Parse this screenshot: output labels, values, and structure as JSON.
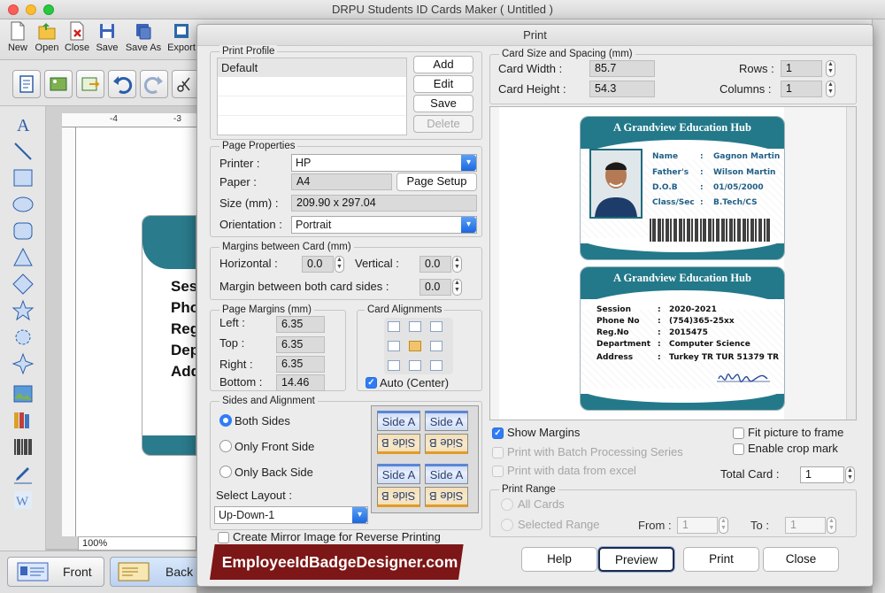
{
  "app": {
    "title": "DRPU Students ID Cards Maker ( Untitled )"
  },
  "toolbar": {
    "new": "New",
    "open": "Open",
    "close": "Close",
    "save": "Save",
    "save_as": "Save As",
    "export": "Export"
  },
  "canvas": {
    "ruler_ticks": [
      "-4",
      "-3"
    ],
    "zoom": "100%",
    "card_lines": [
      "Sess",
      "Pho",
      "Reg",
      "Dep",
      "Add"
    ]
  },
  "bottom_tabs": {
    "front": "Front",
    "back": "Back"
  },
  "dialog": {
    "title": "Print",
    "print_profile": {
      "legend": "Print Profile",
      "items": [
        "Default"
      ],
      "add": "Add",
      "edit": "Edit",
      "save": "Save",
      "delete": "Delete"
    },
    "page_properties": {
      "legend": "Page Properties",
      "printer_label": "Printer :",
      "printer_value": "HP",
      "paper_label": "Paper :",
      "paper_value": "A4",
      "page_setup": "Page Setup",
      "size_label": "Size (mm) :",
      "size_value": "209.90 x 297.04",
      "orientation_label": "Orientation :",
      "orientation_value": "Portrait"
    },
    "margins_between_card": {
      "legend": "Margins between Card (mm)",
      "horizontal_label": "Horizontal :",
      "horizontal_value": "0.0",
      "vertical_label": "Vertical :",
      "vertical_value": "0.0",
      "both_sides_label": "Margin between both card sides :",
      "both_sides_value": "0.0"
    },
    "page_margins": {
      "legend": "Page Margins (mm)",
      "left_label": "Left :",
      "left_value": "6.35",
      "top_label": "Top :",
      "top_value": "6.35",
      "right_label": "Right :",
      "right_value": "6.35",
      "bottom_label": "Bottom :",
      "bottom_value": "14.46"
    },
    "card_alignments": {
      "legend": "Card Alignments",
      "auto_center": "Auto (Center)",
      "auto_center_checked": true
    },
    "sides": {
      "legend": "Sides and Alignment",
      "both": "Both Sides",
      "front_only": "Only Front Side",
      "back_only": "Only Back Side",
      "selected": "both",
      "select_layout_label": "Select Layout :",
      "layout_value": "Up-Down-1",
      "tile_a": "Side A",
      "tile_b": "Side B"
    },
    "mirror": "Create Mirror Image for Reverse Printing",
    "card_size": {
      "legend": "Card Size and Spacing (mm)",
      "width_label": "Card Width :",
      "width_value": "85.7",
      "height_label": "Card Height :",
      "height_value": "54.3",
      "rows_label": "Rows :",
      "rows_value": "1",
      "columns_label": "Columns :",
      "columns_value": "1"
    },
    "preview": {
      "front": {
        "school": "A Grandview Education Hub",
        "fields": [
          {
            "k": "Name",
            "v": "Gagnon Martin"
          },
          {
            "k": "Father's",
            "v": "Wilson Martin"
          },
          {
            "k": "D.O.B",
            "v": "01/05/2000"
          },
          {
            "k": "Class/Sec",
            "v": "B.Tech/CS"
          }
        ]
      },
      "back": {
        "school": "A Grandview Education Hub",
        "fields": [
          {
            "k": "Session",
            "v": "2020-2021"
          },
          {
            "k": "Phone No",
            "v": "(754)365-25xx"
          },
          {
            "k": "Reg.No",
            "v": "2015475"
          },
          {
            "k": "Department",
            "v": "Computer Science"
          },
          {
            "k": "Address",
            "v": "Turkey TR TUR 51379 TR"
          }
        ]
      }
    },
    "options": {
      "show_margins": "Show Margins",
      "batch": "Print with Batch Processing Series",
      "excel": "Print with data from excel",
      "fit_picture": "Fit picture to frame",
      "crop_mark": "Enable crop mark",
      "total_card_label": "Total Card :",
      "total_card_value": "1"
    },
    "print_range": {
      "legend": "Print Range",
      "all": "All Cards",
      "selected": "Selected Range",
      "from_label": "From :",
      "from_value": "1",
      "to_label": "To :",
      "to_value": "1"
    },
    "buttons": {
      "help": "Help",
      "preview": "Preview",
      "print": "Print",
      "close": "Close"
    }
  },
  "watermark": "EmployeeIdBadgeDesigner.com",
  "colors": {
    "card_teal": "#23798a",
    "accent_blue": "#2f7cf6",
    "watermark": "#7d1616"
  }
}
